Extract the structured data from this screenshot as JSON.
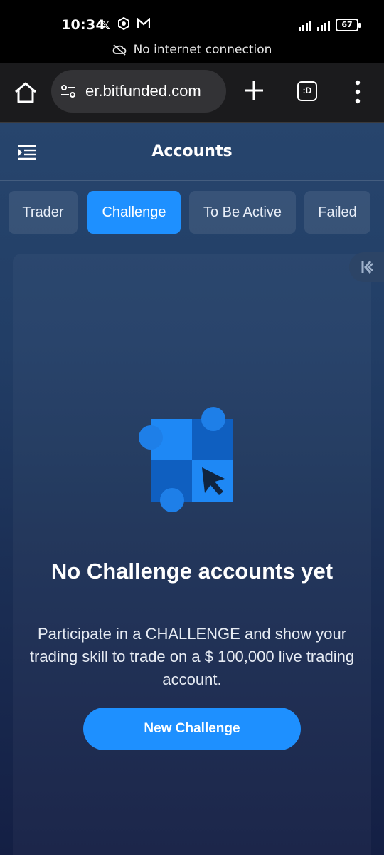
{
  "status_bar": {
    "time": "10:34",
    "notification_icons": [
      "x-icon",
      "app-icon",
      "mail-icon"
    ],
    "battery": "67",
    "network_notice": "No internet connection"
  },
  "browser": {
    "url_visible": "er.bitfunded.com",
    "tab_switcher_label": ":D"
  },
  "app": {
    "title": "Accounts",
    "tabs": [
      {
        "label": "Trader",
        "active": false
      },
      {
        "label": "Challenge",
        "active": true
      },
      {
        "label": "To Be Active",
        "active": false
      },
      {
        "label": "Failed",
        "active": false
      }
    ],
    "empty_state": {
      "title": "No Challenge accounts yet",
      "description": "Participate in a CHALLENGE and show your trading skill to trade on a $ 100,000 live trading account.",
      "button_label": "New Challenge"
    }
  },
  "colors": {
    "accent": "#1e90ff",
    "background_top": "#27456d",
    "background_bottom": "#141f44"
  }
}
